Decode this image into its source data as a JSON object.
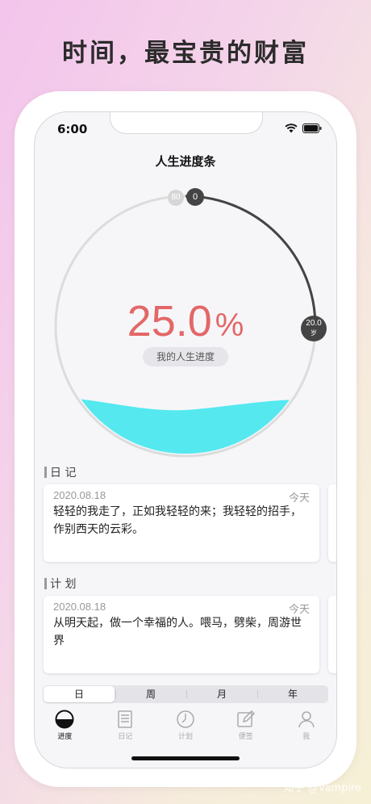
{
  "headline": "时间，最宝贵的财富",
  "status": {
    "time": "6:00"
  },
  "page_title": "人生进度条",
  "progress": {
    "percent_value": "25.0",
    "percent_sign": "%",
    "label": "我的人生进度",
    "fraction": 0.25,
    "marker_max": "80",
    "marker_start": "0",
    "marker_age_value": "20.0",
    "marker_age_unit": "岁"
  },
  "sections": {
    "diary": {
      "title": "日 记",
      "date": "2020.08.18",
      "when": "今天",
      "text": "轻轻的我走了，正如我轻轻的来；我轻轻的招手，作别西天的云彩。"
    },
    "plan": {
      "title": "计 划",
      "date": "2020.08.18",
      "when": "今天",
      "text": "从明天起，做一个幸福的人。喂马，劈柴，周游世界"
    }
  },
  "period_tabs": [
    "日",
    "周",
    "月",
    "年"
  ],
  "tabbar": [
    {
      "label": "进度",
      "icon": "progress-icon",
      "active": true
    },
    {
      "label": "日记",
      "icon": "diary-icon",
      "active": false
    },
    {
      "label": "计划",
      "icon": "clock-icon",
      "active": false
    },
    {
      "label": "便签",
      "icon": "note-edit-icon",
      "active": false
    },
    {
      "label": "我",
      "icon": "person-icon",
      "active": false
    }
  ],
  "watermark": "知乎 @Vampire",
  "colors": {
    "accent_red": "#e36767",
    "water": "#55e8ef",
    "ring_dark": "#444444",
    "ring_light": "#dcdcdc"
  }
}
